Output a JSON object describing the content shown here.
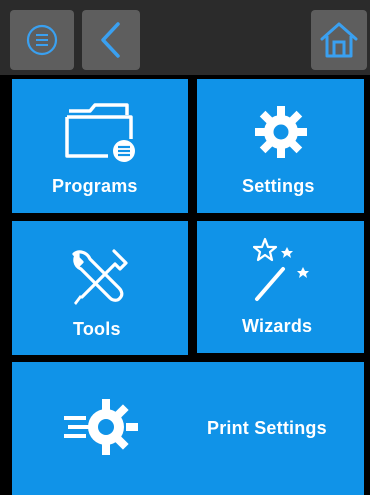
{
  "colors": {
    "header_bg": "#2b2b2b",
    "header_button_bg": "#5e5e5e",
    "tile_bg": "#1093e8",
    "icon_color": "#ffffff"
  },
  "header": {
    "buttons": [
      {
        "id": "menu",
        "icon": "menu-lines-icon"
      },
      {
        "id": "back",
        "icon": "chevron-left-icon"
      },
      {
        "id": "home",
        "icon": "home-icon"
      }
    ]
  },
  "tiles": {
    "programs": {
      "label": "Programs",
      "icon": "folder-icon"
    },
    "settings": {
      "label": "Settings",
      "icon": "gear-icon"
    },
    "tools": {
      "label": "Tools",
      "icon": "wrench-screwdriver-icon"
    },
    "wizards": {
      "label": "Wizards",
      "icon": "magic-wand-icon"
    },
    "print_settings": {
      "label": "Print Settings",
      "icon": "speed-gear-icon"
    }
  }
}
